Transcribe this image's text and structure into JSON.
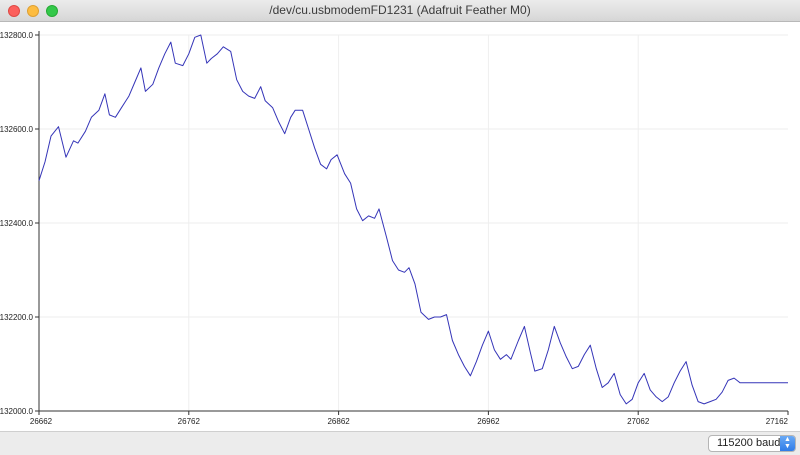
{
  "window": {
    "title": "/dev/cu.usbmodemFD1231 (Adafruit Feather M0)"
  },
  "baud": {
    "selected": "115200 baud"
  },
  "colors": {
    "line": "#3535b8",
    "axis": "#333333",
    "grid": "#eeeeee"
  },
  "chart_data": {
    "type": "line",
    "xlim": [
      26662,
      27162
    ],
    "ylim": [
      132000,
      132800
    ],
    "xticks": [
      26662,
      26762,
      26862,
      26962,
      27062,
      27162
    ],
    "yticks": [
      132000,
      132200,
      132400,
      132600,
      132800
    ],
    "xtick_labels": [
      "26662",
      "26762",
      "26862",
      "26962",
      "27062",
      "27162"
    ],
    "ytick_labels": [
      "132000.0",
      "132200.0",
      "132400.0",
      "132600.0",
      "132800.0"
    ],
    "series": [
      {
        "x": [
          26662,
          26666,
          26670,
          26675,
          26680,
          26685,
          26688,
          26693,
          26697,
          26702,
          26706,
          26709,
          26713,
          26717,
          26722,
          26726,
          26730,
          26733,
          26738,
          26742,
          26746,
          26750,
          26753,
          26758,
          26762,
          26766,
          26770,
          26774,
          26777,
          26781,
          26785,
          26790,
          26794,
          26798,
          26802,
          26806,
          26810,
          26813,
          26818,
          26822,
          26826,
          26830,
          26833,
          26838,
          26842,
          26846,
          26850,
          26854,
          26857,
          26861,
          26866,
          26870,
          26874,
          26878,
          26882,
          26886,
          26889,
          26894,
          26898,
          26902,
          26906,
          26909,
          26913,
          26917,
          26922,
          26926,
          26930,
          26934,
          26938,
          26942,
          26946,
          26950,
          26954,
          26958,
          26962,
          26966,
          26970,
          26974,
          26977,
          26982,
          26986,
          26990,
          26993,
          26998,
          27002,
          27006,
          27010,
          27014,
          27018,
          27022,
          27026,
          27030,
          27034,
          27038,
          27042,
          27046,
          27050,
          27054,
          27058,
          27062,
          27066,
          27070,
          27074,
          27078,
          27082,
          27086,
          27090,
          27094,
          27098,
          27102,
          27106,
          27110,
          27114,
          27118,
          27122,
          27126,
          27130,
          27134,
          27138,
          27142,
          27146,
          27150,
          27154,
          27158,
          27162
        ],
        "y": [
          132490,
          132530,
          132585,
          132605,
          132540,
          132575,
          132570,
          132595,
          132625,
          132640,
          132675,
          132630,
          132625,
          132645,
          132670,
          132700,
          132730,
          132680,
          132695,
          132730,
          132760,
          132785,
          132740,
          132735,
          132760,
          132795,
          132800,
          132740,
          132750,
          132760,
          132775,
          132765,
          132705,
          132680,
          132670,
          132665,
          132690,
          132660,
          132645,
          132615,
          132590,
          132625,
          132640,
          132640,
          132600,
          132560,
          132525,
          132515,
          132535,
          132545,
          132505,
          132485,
          132430,
          132405,
          132415,
          132410,
          132430,
          132370,
          132320,
          132300,
          132295,
          132305,
          132270,
          132210,
          132195,
          132200,
          132200,
          132205,
          132150,
          132120,
          132095,
          132075,
          132105,
          132140,
          132170,
          132130,
          132110,
          132120,
          132110,
          132150,
          132180,
          132125,
          132085,
          132090,
          132130,
          132180,
          132145,
          132115,
          132090,
          132095,
          132120,
          132140,
          132090,
          132050,
          132060,
          132080,
          132035,
          132015,
          132025,
          132060,
          132080,
          132045,
          132030,
          132020,
          132030,
          132060,
          132085,
          132105,
          132055,
          132020,
          132015,
          132020,
          132025,
          132040,
          132065,
          132070,
          132060,
          132060,
          132060,
          132060,
          132060,
          132060,
          132060,
          132060,
          132060
        ]
      }
    ]
  }
}
